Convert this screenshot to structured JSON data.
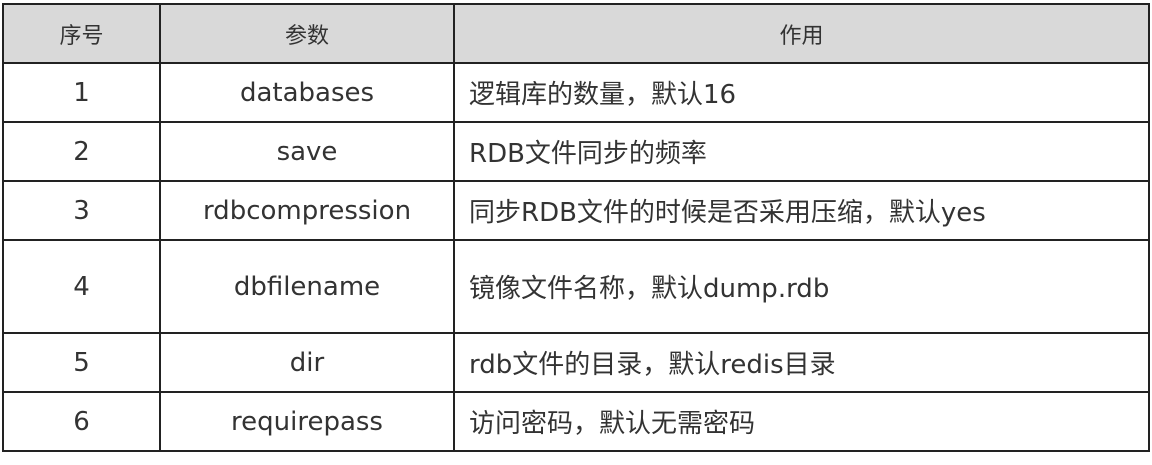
{
  "headers": [
    "序号",
    "参数",
    "作用"
  ],
  "rows": [
    {
      "no": "1",
      "param": "databases",
      "desc": "逻辑库的数量，默认16"
    },
    {
      "no": "2",
      "param": "save",
      "desc": "RDB文件同步的频率"
    },
    {
      "no": "3",
      "param": "rdbcompression",
      "desc": "同步RDB文件的时候是否采用压缩，默认yes"
    },
    {
      "no": "4",
      "param": "dbfilename",
      "desc": "镜像文件名称，默认dump.rdb"
    },
    {
      "no": "5",
      "param": "dir",
      "desc": "rdb文件的目录，默认redis目录"
    },
    {
      "no": "6",
      "param": "requirepass",
      "desc": "访问密码，默认无需密码"
    }
  ]
}
